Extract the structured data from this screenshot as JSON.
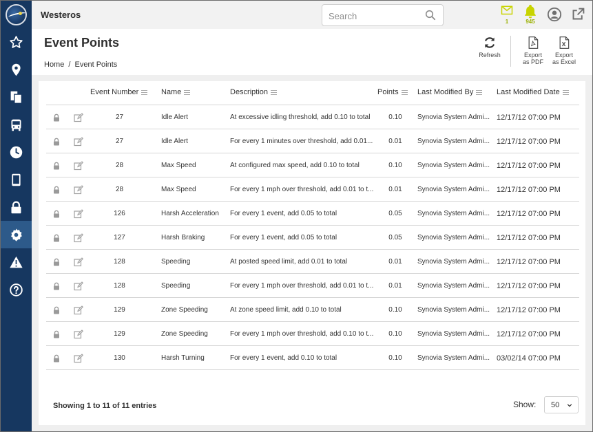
{
  "app": {
    "name": "Westeros"
  },
  "colors": {
    "sidebar": "#163760",
    "sidebar_active": "#2d5a8a",
    "notify": "#c8d400",
    "badge_text": "#9ab000"
  },
  "sidebar": {
    "items": [
      {
        "icon": "star-icon",
        "label": "Favorites"
      },
      {
        "icon": "map-pin-icon",
        "label": "Map"
      },
      {
        "icon": "documents-icon",
        "label": "Reports"
      },
      {
        "icon": "bus-icon",
        "label": "Vehicles"
      },
      {
        "icon": "clock-icon",
        "label": "History"
      },
      {
        "icon": "tablet-icon",
        "label": "Devices"
      },
      {
        "icon": "lock-icon",
        "label": "Security"
      },
      {
        "icon": "gear-icon",
        "label": "Settings",
        "active": true
      },
      {
        "icon": "warning-icon",
        "label": "Alerts"
      },
      {
        "icon": "help-icon",
        "label": "Help"
      }
    ]
  },
  "search": {
    "placeholder": "Search"
  },
  "notifications": {
    "mail_count": "1",
    "alert_count": "945"
  },
  "page": {
    "title": "Event Points",
    "breadcrumb": [
      "Home",
      "/",
      "Event Points"
    ]
  },
  "toolbar": {
    "refresh_label": "Refresh",
    "export_pdf_line1": "Export",
    "export_pdf_line2": "as PDF",
    "export_excel_line1": "Export",
    "export_excel_line2": "as Excel"
  },
  "table": {
    "headers": {
      "event_number": "Event Number",
      "name": "Name",
      "description": "Description",
      "points": "Points",
      "last_modified_by": "Last Modified By",
      "last_modified_date": "Last Modified Date"
    },
    "rows": [
      {
        "event_number": "27",
        "name": "Idle Alert",
        "description": "At excessive idling threshold, add 0.10 to total",
        "points": "0.10",
        "modified_by": "Synovia System Admi...",
        "modified_date": "12/17/12 07:00 PM"
      },
      {
        "event_number": "27",
        "name": "Idle Alert",
        "description": "For every 1 minutes over threshold, add 0.01...",
        "points": "0.01",
        "modified_by": "Synovia System Admi...",
        "modified_date": "12/17/12 07:00 PM"
      },
      {
        "event_number": "28",
        "name": "Max Speed",
        "description": "At configured max speed, add 0.10 to total",
        "points": "0.10",
        "modified_by": "Synovia System Admi...",
        "modified_date": "12/17/12 07:00 PM"
      },
      {
        "event_number": "28",
        "name": "Max Speed",
        "description": "For every 1 mph over threshold, add 0.01 to t...",
        "points": "0.01",
        "modified_by": "Synovia System Admi...",
        "modified_date": "12/17/12 07:00 PM"
      },
      {
        "event_number": "126",
        "name": "Harsh Acceleration",
        "description": "For every 1 event, add 0.05 to total",
        "points": "0.05",
        "modified_by": "Synovia System Admi...",
        "modified_date": "12/17/12 07:00 PM"
      },
      {
        "event_number": "127",
        "name": "Harsh Braking",
        "description": "For every 1 event, add 0.05 to total",
        "points": "0.05",
        "modified_by": "Synovia System Admi...",
        "modified_date": "12/17/12 07:00 PM"
      },
      {
        "event_number": "128",
        "name": "Speeding",
        "description": "At posted speed limit, add 0.01 to total",
        "points": "0.01",
        "modified_by": "Synovia System Admi...",
        "modified_date": "12/17/12 07:00 PM"
      },
      {
        "event_number": "128",
        "name": "Speeding",
        "description": "For every 1 mph over threshold, add 0.01 to t...",
        "points": "0.01",
        "modified_by": "Synovia System Admi...",
        "modified_date": "12/17/12 07:00 PM"
      },
      {
        "event_number": "129",
        "name": "Zone Speeding",
        "description": "At zone speed limit, add 0.10 to total",
        "points": "0.10",
        "modified_by": "Synovia System Admi...",
        "modified_date": "12/17/12 07:00 PM"
      },
      {
        "event_number": "129",
        "name": "Zone Speeding",
        "description": "For every 1 mph over threshold, add 0.10 to t...",
        "points": "0.10",
        "modified_by": "Synovia System Admi...",
        "modified_date": "12/17/12 07:00 PM"
      },
      {
        "event_number": "130",
        "name": "Harsh Turning",
        "description": "For every 1 event, add 0.10 to total",
        "points": "0.10",
        "modified_by": "Synovia System Admi...",
        "modified_date": "03/02/14 07:00 PM"
      }
    ]
  },
  "footer": {
    "entries_text": "Showing 1 to 11 of 11 entries",
    "show_label": "Show:",
    "page_size": "50"
  }
}
